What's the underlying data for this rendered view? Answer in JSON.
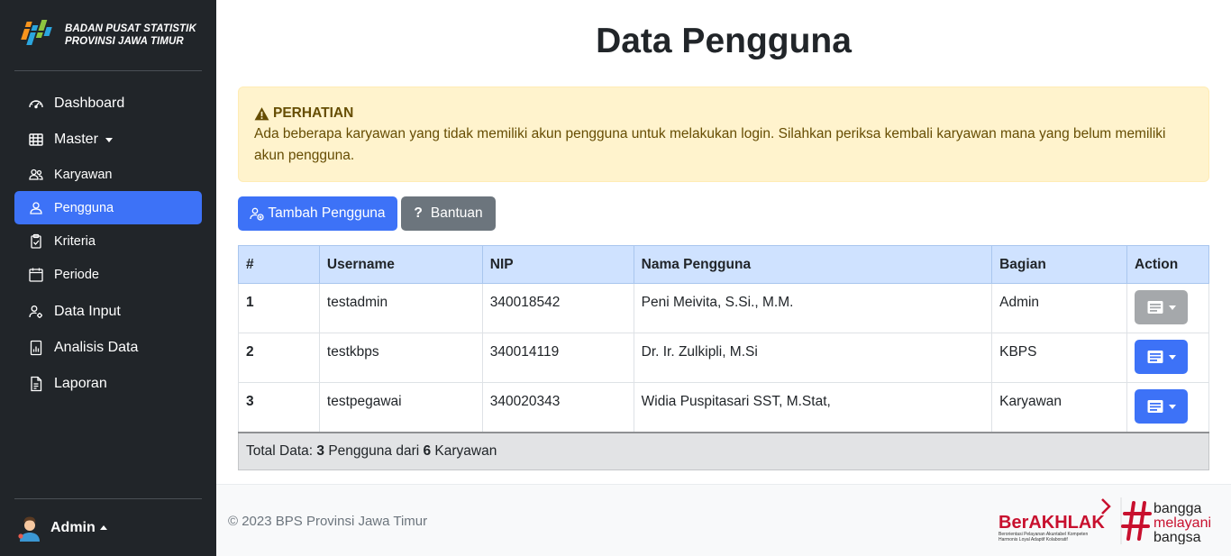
{
  "brand": {
    "line1": "BADAN PUSAT STATISTIK",
    "line2": "PROVINSI JAWA TIMUR"
  },
  "sidebar": {
    "items": [
      {
        "label": "Dashboard",
        "icon": "speedometer-icon"
      },
      {
        "label": "Master",
        "icon": "table-icon"
      },
      {
        "label": "Karyawan",
        "icon": "people-icon"
      },
      {
        "label": "Pengguna",
        "icon": "person-icon",
        "active": true
      },
      {
        "label": "Kriteria",
        "icon": "clipboard-check-icon"
      },
      {
        "label": "Periode",
        "icon": "calendar-icon"
      },
      {
        "label": "Data Input",
        "icon": "person-gear-icon"
      },
      {
        "label": "Analisis Data",
        "icon": "bar-chart-file-icon"
      },
      {
        "label": "Laporan",
        "icon": "document-icon"
      }
    ],
    "user": "Admin"
  },
  "page": {
    "title": "Data Pengguna"
  },
  "alert": {
    "title": "PERHATIAN",
    "text": "Ada beberapa karyawan yang tidak memiliki akun pengguna untuk melakukan login. Silahkan periksa kembali karyawan mana yang belum memiliki akun pengguna."
  },
  "buttons": {
    "add": "Tambah Pengguna",
    "help": "Bantuan",
    "help_symbol": "?"
  },
  "table": {
    "headers": [
      "#",
      "Username",
      "NIP",
      "Nama Pengguna",
      "Bagian",
      "Action"
    ],
    "rows": [
      {
        "no": "1",
        "username": "testadmin",
        "nip": "340018542",
        "nama": "Peni Meivita, S.Si., M.M.",
        "bagian": "Admin",
        "action_disabled": true
      },
      {
        "no": "2",
        "username": "testkbps",
        "nip": "340014119",
        "nama": "Dr. Ir. Zulkipli, M.Si",
        "bagian": "KBPS",
        "action_disabled": false
      },
      {
        "no": "3",
        "username": "testpegawai",
        "nip": "340020343",
        "nama": "Widia Puspitasari SST, M.Stat,",
        "bagian": "Karyawan",
        "action_disabled": false
      }
    ],
    "footer": {
      "prefix": "Total Data: ",
      "count_users": "3",
      "middle": " Pengguna dari ",
      "count_employees": "6",
      "suffix": " Karyawan"
    }
  },
  "footer": {
    "copyright": "© 2023 BPS Provinsi Jawa Timur",
    "berakhlak": "BerAKHLAK",
    "berakhlak_tagline1": "Berorientasi Pelayanan Akuntabel Kompeten",
    "berakhlak_tagline2": "Harmonis Loyal Adaptif Kolaboratif",
    "bangga": [
      "bangga",
      "melayani",
      "bangsa"
    ]
  },
  "colors": {
    "sidebar_bg": "#212529",
    "primary": "#3d72f7",
    "secondary": "#6c757d",
    "alert_bg": "#fff3cd",
    "table_head": "#cfe2ff"
  }
}
